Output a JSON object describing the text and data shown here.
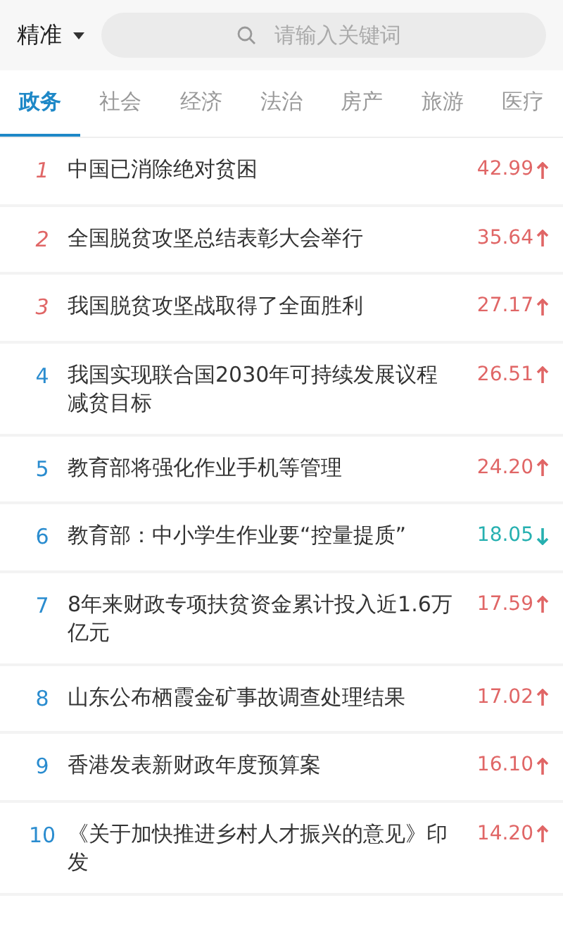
{
  "search_bar": {
    "mode": "精准",
    "placeholder": "请输入关键词"
  },
  "tabs": [
    {
      "label": "政务",
      "selected": true
    },
    {
      "label": "社会",
      "selected": false
    },
    {
      "label": "经济",
      "selected": false
    },
    {
      "label": "法治",
      "selected": false
    },
    {
      "label": "房产",
      "selected": false
    },
    {
      "label": "旅游",
      "selected": false
    },
    {
      "label": "医疗",
      "selected": false
    }
  ],
  "rows": [
    {
      "rank": "1",
      "top": true,
      "title": "中国已消除绝对贫困",
      "score": "42.99",
      "rising": true
    },
    {
      "rank": "2",
      "top": true,
      "title": "全国脱贫攻坚总结表彰大会举行",
      "score": "35.64",
      "rising": true
    },
    {
      "rank": "3",
      "top": true,
      "title": "我国脱贫攻坚战取得了全面胜利",
      "score": "27.17",
      "rising": true
    },
    {
      "rank": "4",
      "top": false,
      "title": "我国实现联合国2030年可持续发展议程减贫目标",
      "score": "26.51",
      "rising": true
    },
    {
      "rank": "5",
      "top": false,
      "title": "教育部将强化作业手机等管理",
      "score": "24.20",
      "rising": true
    },
    {
      "rank": "6",
      "top": false,
      "title": "教育部：中小学生作业要“控量提质”",
      "score": "18.05",
      "rising": false
    },
    {
      "rank": "7",
      "top": false,
      "title": "8年来财政专项扶贫资金累计投入近1.6万亿元",
      "score": "17.59",
      "rising": true
    },
    {
      "rank": "8",
      "top": false,
      "title": "山东公布栖霞金矿事故调查处理结果",
      "score": "17.02",
      "rising": true
    },
    {
      "rank": "9",
      "top": false,
      "title": "香港发表新财政年度预算案",
      "score": "16.10",
      "rising": true
    },
    {
      "rank": "10",
      "top": false,
      "title": "《关于加快推进乡村人才振兴的意见》印发",
      "score": "14.20",
      "rising": true
    }
  ]
}
